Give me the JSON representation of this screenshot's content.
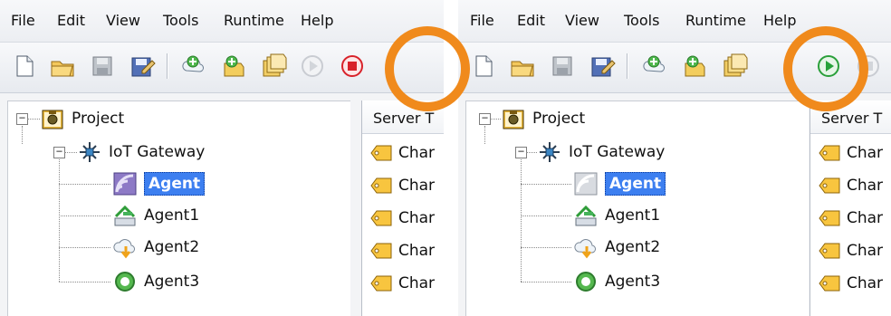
{
  "left": {
    "menu": [
      "File",
      "Edit",
      "View",
      "Tools",
      "Runtime",
      "Help"
    ],
    "toolbar": {
      "highlighted_action": "stop-runtime",
      "icons": [
        "new-project-icon",
        "open-folder-icon",
        "save-icon",
        "save-as-icon",
        "add-agent-icon",
        "add-item-icon",
        "duplicate-icon",
        "start-runtime-disabled-icon",
        "stop-runtime-icon"
      ]
    },
    "tree": {
      "root": "Project",
      "gateway": "IoT Gateway",
      "items": [
        {
          "label": "Agent",
          "icon": "agent-purple-icon",
          "selected": true
        },
        {
          "label": "Agent1",
          "icon": "agent-green-icon",
          "selected": false
        },
        {
          "label": "Agent2",
          "icon": "agent-cloud-icon",
          "selected": false
        },
        {
          "label": "Agent3",
          "icon": "agent-ring-icon",
          "selected": false
        }
      ]
    },
    "pane": {
      "header": "Server T",
      "rows": [
        "Char",
        "Char",
        "Char",
        "Char",
        "Char"
      ]
    }
  },
  "right": {
    "menu": [
      "File",
      "Edit",
      "View",
      "Tools",
      "Runtime",
      "Help"
    ],
    "toolbar": {
      "highlighted_action": "start-runtime",
      "icons": [
        "new-project-icon",
        "open-folder-icon",
        "save-icon",
        "save-as-icon",
        "add-agent-icon",
        "add-item-icon",
        "duplicate-icon",
        "start-runtime-icon",
        "stop-runtime-disabled-icon"
      ]
    },
    "tree": {
      "root": "Project",
      "gateway": "IoT Gateway",
      "items": [
        {
          "label": "Agent",
          "icon": "agent-gray-icon",
          "selected": true
        },
        {
          "label": "Agent1",
          "icon": "agent-green-icon",
          "selected": false
        },
        {
          "label": "Agent2",
          "icon": "agent-cloud-icon",
          "selected": false
        },
        {
          "label": "Agent3",
          "icon": "agent-ring-icon",
          "selected": false
        }
      ]
    },
    "pane": {
      "header": "Server T",
      "rows": [
        "Char",
        "Char",
        "Char",
        "Char",
        "Char"
      ]
    }
  },
  "colors": {
    "highlight": "#f08a1c",
    "selection": "#3d7ff0",
    "stop": "#d8222a",
    "start": "#27a13a"
  }
}
